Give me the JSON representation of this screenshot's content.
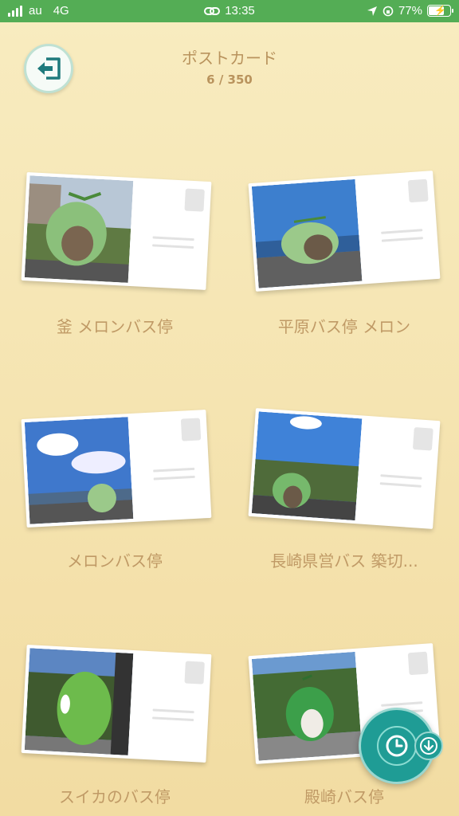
{
  "status_bar": {
    "carrier": "au",
    "network": "4G",
    "time": "13:35",
    "battery": "77%",
    "battery_level": 0.77
  },
  "header": {
    "title": "ポストカード",
    "counter": "6 / 350",
    "back_icon": "exit-icon"
  },
  "postcards": [
    {
      "label": "釜 メロンバス停"
    },
    {
      "label": "平原バス停 メロン"
    },
    {
      "label": "メロンバス停"
    },
    {
      "label": "長崎県営バス 築切..."
    },
    {
      "label": "スイカのバス停"
    },
    {
      "label": "殿崎バス停"
    }
  ],
  "fab": {
    "icon": "clock-icon",
    "badge_icon": "download-icon"
  },
  "colors": {
    "status_green": "#54ad55",
    "accent_teal": "#1f9c95",
    "label_brown": "#c09a66"
  }
}
